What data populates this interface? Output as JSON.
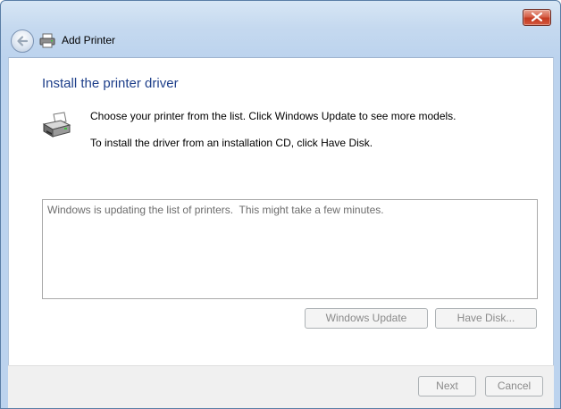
{
  "window": {
    "title": "Add Printer"
  },
  "content": {
    "heading": "Install the printer driver",
    "instruction_1": "Choose your printer from the list. Click Windows Update to see more models.",
    "instruction_2": "To install the driver from an installation CD, click Have Disk."
  },
  "printer_list": {
    "status_text": "Windows is updating the list of printers.  This might take a few minutes."
  },
  "buttons": {
    "windows_update": "Windows Update",
    "have_disk": "Have Disk...",
    "next": "Next",
    "cancel": "Cancel"
  },
  "icons": {
    "close": "close-icon",
    "back": "back-arrow-icon",
    "title_printer": "printer-icon",
    "heading_printer": "printer-icon"
  },
  "colors": {
    "heading": "#1e3f8a",
    "close_button": "#c43b22",
    "disabled_text": "#8a8a8a"
  }
}
